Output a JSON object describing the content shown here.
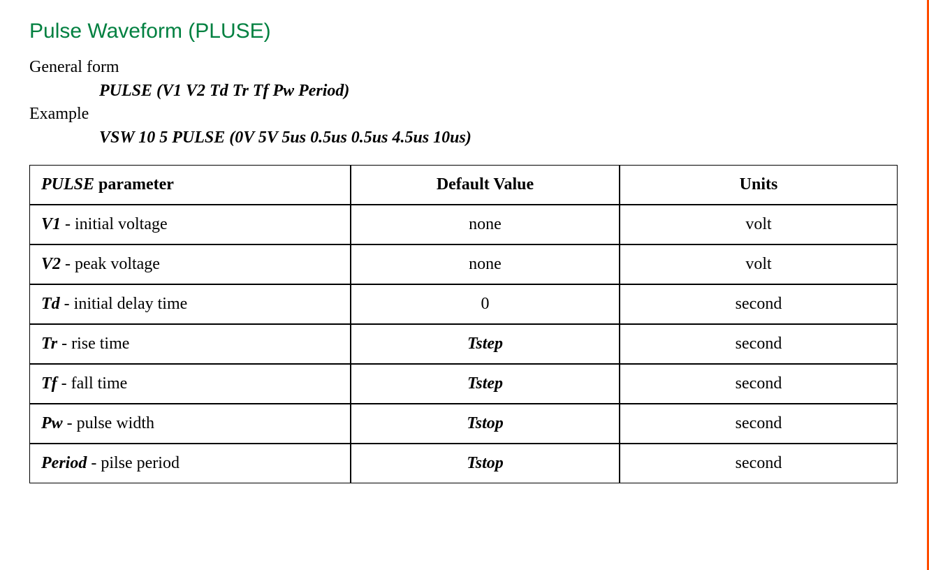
{
  "section": {
    "title": "Pulse Waveform (PLUSE)",
    "general_form_label": "General form",
    "general_form_syntax": "PULSE (V1 V2 Td Tr Tf Pw Period)",
    "example_label": "Example",
    "example_syntax": "VSW 10 5 PULSE (0V 5V 5us 0.5us 0.5us 4.5us 10us)"
  },
  "table": {
    "headers": {
      "param_title_ital": "PULSE",
      "param_title_rest": " parameter",
      "default_value": "Default Value",
      "units": "Units"
    },
    "rows": [
      {
        "name": "V1",
        "desc": " - initial voltage",
        "default": "none",
        "default_italic": false,
        "units": "volt"
      },
      {
        "name": "V2",
        "desc": " - peak voltage",
        "default": "none",
        "default_italic": false,
        "units": "volt"
      },
      {
        "name": "Td",
        "desc": " - initial delay time",
        "default": "0",
        "default_italic": false,
        "units": "second"
      },
      {
        "name": "Tr",
        "desc": " - rise time",
        "default": "Tstep",
        "default_italic": true,
        "units": "second"
      },
      {
        "name": "Tf",
        "desc": " - fall time",
        "default": "Tstep",
        "default_italic": true,
        "units": "second"
      },
      {
        "name": "Pw",
        "desc": " - pulse width",
        "default": "Tstop",
        "default_italic": true,
        "units": "second"
      },
      {
        "name": "Period",
        "desc": " - pilse period",
        "default": "Tstop",
        "default_italic": true,
        "units": "second"
      }
    ]
  }
}
